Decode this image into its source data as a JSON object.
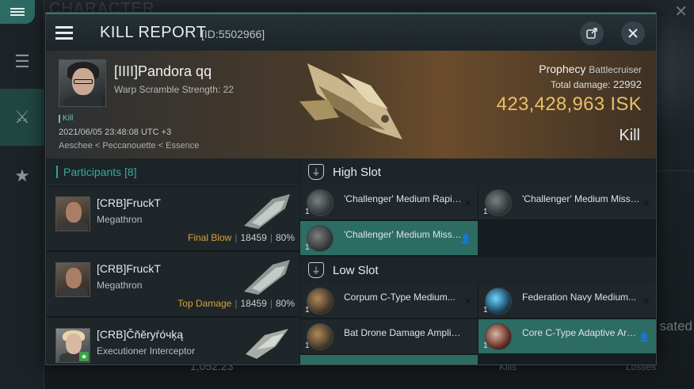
{
  "background": {
    "title": "CHARACTER",
    "close_glyph": "✕",
    "right_text": "sated",
    "bottom_value": "1,052.23",
    "kills_label": "Kills",
    "losses_label": "Losses"
  },
  "header": {
    "title": "KILL REPORT",
    "id": "[ID:5502966]",
    "share_icon": "share-icon",
    "close_icon": "close-icon"
  },
  "victim": {
    "name": "[IIII]Pandora qq",
    "subtitle": "Warp Scramble Strength: 22",
    "tag": "Kill",
    "date": "2021/06/05 23:48:08 UTC +3",
    "location": "Aeschee < Peccanouette < Essence",
    "ship": "Prophecy",
    "ship_class": "Battlecruiser",
    "total_damage_label": "Total damage:",
    "total_damage": "22992",
    "isk": "423,428,963",
    "isk_unit": "ISK",
    "result": "Kill"
  },
  "participants": {
    "label": "Participants",
    "count": "[8]",
    "rows": [
      {
        "name": "[CRB]FruckT",
        "ship": "Megathron",
        "role": "Final Blow",
        "damage": "18459",
        "percent": "80%"
      },
      {
        "name": "[CRB]FruckT",
        "ship": "Megathron",
        "role": "Top Damage",
        "damage": "18459",
        "percent": "80%"
      },
      {
        "name": "[CRB]Čňěryŕóчķą",
        "ship": "Executioner Interceptor",
        "role": "",
        "damage": "",
        "percent": ""
      }
    ]
  },
  "high_slot": {
    "label": "High Slot",
    "modules": [
      {
        "name": "'Challenger' Medium Rapid...",
        "qty": "1",
        "mark": "✕"
      },
      {
        "name": "'Challenger' Medium Missile ...",
        "qty": "1",
        "mark": "✕"
      },
      {
        "name": "'Challenger' Medium Missile...",
        "qty": "1",
        "mark": "👤"
      }
    ]
  },
  "low_slot": {
    "label": "Low Slot",
    "modules": [
      {
        "name": "Corpum C-Type Medium...",
        "qty": "1",
        "mark": "✕"
      },
      {
        "name": "Federation Navy Medium...",
        "qty": "1",
        "mark": "✕"
      },
      {
        "name": "Bat Drone Damage Amplifier",
        "qty": "1",
        "mark": ""
      },
      {
        "name": "Core C-Type Adaptive Arme...",
        "qty": "1",
        "mark": "👤"
      }
    ]
  }
}
